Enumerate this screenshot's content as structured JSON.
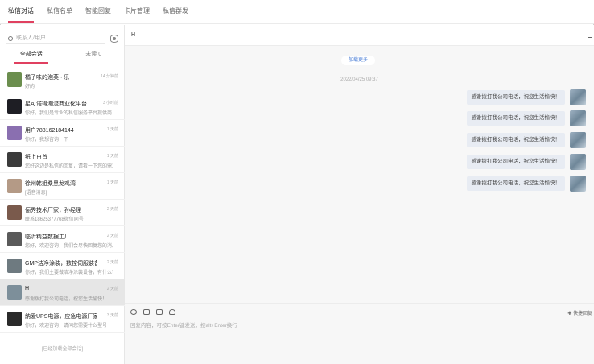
{
  "nav": {
    "tabs": [
      {
        "label": "私信对话",
        "active": true
      },
      {
        "label": "私信名单",
        "active": false
      },
      {
        "label": "智能回复",
        "active": false
      },
      {
        "label": "卡片管理",
        "active": false
      },
      {
        "label": "私信群发",
        "active": false
      }
    ]
  },
  "search": {
    "placeholder": "联系人/用户"
  },
  "subtabs": {
    "all": "全部会话",
    "unread": "未读",
    "unread_count": "0"
  },
  "conversations": [
    {
      "name": "橘子味的泡芙 · 乐",
      "preview": "好的",
      "time": "14 分钟前",
      "color": "#6b8e4e",
      "selected": false
    },
    {
      "name": "星可诺得潮流商业化平台",
      "preview": "你好，我们是专业的私信服务平台提供商",
      "time": "3 小时前",
      "color": "#1e1e24",
      "selected": false
    },
    {
      "name": "用户788162184144",
      "preview": "你好，我想咨询一下",
      "time": "1 天前",
      "color": "#8a6fb0",
      "selected": false
    },
    {
      "name": "纸上白首",
      "preview": "您好这边是私信的回复，请看一下您的需求",
      "time": "1 天前",
      "color": "#3b3b3b",
      "selected": false
    },
    {
      "name": "徐州韩姐桑黑龙鸡湾",
      "preview": "[语音消息]",
      "time": "1 天前",
      "color": "#b49a86",
      "selected": false
    },
    {
      "name": "俪秀技术厂家，孙经理",
      "preview": "联系18625377768微信同号",
      "time": "2 天前",
      "color": "#7a5a4c",
      "selected": false
    },
    {
      "name": "临沂精益数据工厂",
      "preview": "您好，欢迎咨询，我们会尽快回复您的消息",
      "time": "2 天前",
      "color": "#5a5a5a",
      "selected": false
    },
    {
      "name": "GMP洁净涂装，数控伺服装备",
      "preview": "你好，我们主要做洁净涂装设备，有什么可以",
      "time": "2 天前",
      "color": "#6e7a80",
      "selected": false
    },
    {
      "name": "H",
      "preview": "感谢拨打我公司电话，祝您生活愉快！",
      "time": "2 天前",
      "color": "#7d8f9a",
      "selected": true
    },
    {
      "name": "納爱UPS电源，应急电源厂家",
      "preview": "你好，欢迎咨询，请问您需要什么型号",
      "time": "3 天前",
      "color": "#2a2a2a",
      "selected": false
    }
  ],
  "load_more": "[已经加载全部会话]",
  "chat": {
    "title": "H",
    "load_history": "加载更多",
    "timestamp": "2022/04/25 09:37",
    "messages": [
      {
        "text": "感谢拨打我公司电话，祝您生活愉快！"
      },
      {
        "text": "感谢拨打我公司电话，祝您生活愉快！"
      },
      {
        "text": "感谢拨打我公司电话，祝您生活愉快！"
      },
      {
        "text": "感谢拨打我公司电话，祝您生活愉快！"
      },
      {
        "text": "感谢拨打我公司电话，祝您生活愉快！"
      }
    ],
    "quick_reply": "✚ 快捷回复",
    "input_placeholder": "回复内容，可按Enter键发送，按alt+Enter换行"
  }
}
